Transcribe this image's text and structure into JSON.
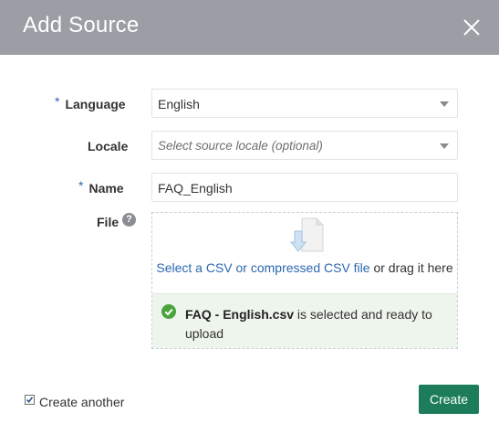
{
  "dialog": {
    "title": "Add Source",
    "close_icon": "close-icon"
  },
  "form": {
    "required_marker": "*",
    "language": {
      "label": "Language",
      "value": "English"
    },
    "locale": {
      "label": "Locale",
      "placeholder": "Select source locale (optional)"
    },
    "name": {
      "label": "Name",
      "value": "FAQ_English"
    },
    "file": {
      "label": "File",
      "help_glyph": "?",
      "drop_link": "Select a CSV or compressed CSV file",
      "drop_suffix": " or drag it here",
      "selected_file": "FAQ - English.csv",
      "selected_suffix": " is selected and ready to upload"
    }
  },
  "footer": {
    "create_another_label": "Create another",
    "create_another_checked": true,
    "create_label": "Create"
  },
  "colors": {
    "header": "#9b9ea5",
    "accent": "#2d67b1",
    "primary_button": "#1d7d5a",
    "success": "#4aa33b"
  }
}
